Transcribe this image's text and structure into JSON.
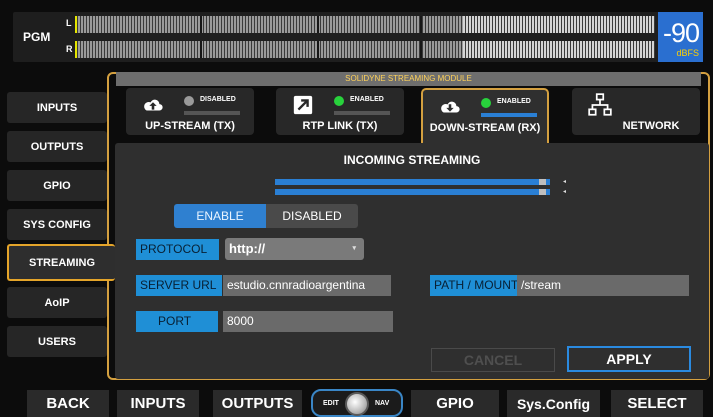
{
  "meter": {
    "label": "PGM",
    "left_channel": "L",
    "right_channel": "R",
    "value": "-90",
    "unit": "dBFS"
  },
  "sidebar": {
    "items": [
      {
        "label": "INPUTS",
        "active": false
      },
      {
        "label": "OUTPUTS",
        "active": false
      },
      {
        "label": "GPIO",
        "active": false
      },
      {
        "label": "SYS CONFIG",
        "active": false
      },
      {
        "label": "STREAMING",
        "active": true
      },
      {
        "label": "AoIP",
        "active": false
      },
      {
        "label": "USERS",
        "active": false
      }
    ]
  },
  "module": {
    "title": "SOLIDYNE STREAMING MODULE",
    "tabs": [
      {
        "label": "UP-STREAM (TX)",
        "status": "DISABLED",
        "icon": "cloud-upload-icon",
        "led_color": "#9a9a9a"
      },
      {
        "label": "RTP LINK (TX)",
        "status": "ENABLED",
        "icon": "arrow-box-icon",
        "led_color": "#28d23c"
      },
      {
        "label": "DOWN-STREAM (RX)",
        "status": "ENABLED",
        "icon": "cloud-download-icon",
        "led_color": "#28d23c"
      },
      {
        "label": "NETWORK",
        "icon": "network-icon"
      }
    ]
  },
  "panel": {
    "title": "INCOMING STREAMING",
    "toggle": {
      "enable_label": "ENABLE",
      "disabled_label": "DISABLED"
    },
    "fields": {
      "protocol": {
        "label": "PROTOCOL",
        "value": "http://"
      },
      "server_url": {
        "label": "SERVER URL",
        "value": "estudio.cnnradioargentina"
      },
      "path": {
        "label": "PATH / MOUNT",
        "value": "/stream"
      },
      "port": {
        "label": "PORT",
        "value": "8000"
      }
    },
    "cancel_label": "CANCEL",
    "apply_label": "APPLY"
  },
  "bottom_bar": {
    "back": "BACK",
    "inputs": "INPUTS",
    "outputs": "OUTPUTS",
    "knob_left": "EDIT",
    "knob_right": "NAV",
    "gpio": "GPIO",
    "sysconfig": "Sys.Config",
    "select": "SELECT"
  },
  "colors": {
    "accent_orange": "#d4a040",
    "accent_blue": "#2a7fd4",
    "led_green": "#28d23c",
    "meter_yellow": "#ffd000"
  }
}
